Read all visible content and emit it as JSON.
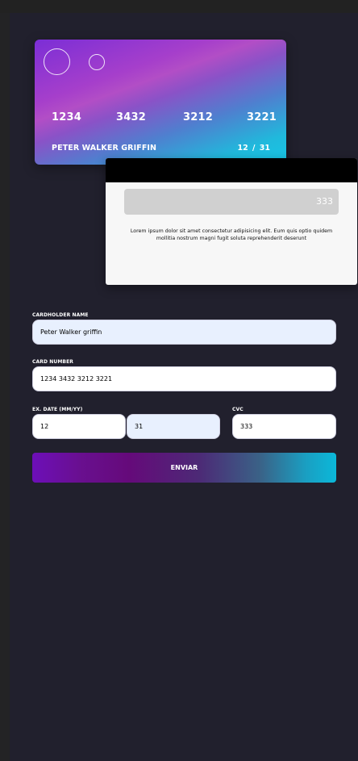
{
  "card_front": {
    "number_groups": [
      "1234",
      "3432",
      "3212",
      "3221"
    ],
    "holder_name": "PETER WALKER GRIFFIN",
    "expiry": "12 / 31"
  },
  "card_back": {
    "cvc": "333",
    "note": "Lorem ipsum dolor sit amet consectetur adipisicing elit. Eum quis optio quidem mollitia nostrum magni fugit soluta reprehenderit deserunt"
  },
  "form": {
    "cardholder_label": "CARDHOLDER NAME",
    "cardholder_value": "Peter Walker griffin",
    "card_number_label": "CARD NUMBER",
    "card_number_value": "1234 3432 3212 3221",
    "exp_label": "EX. DATE (MM/YY)",
    "exp_month_value": "12",
    "exp_year_value": "31",
    "cvc_label": "CVC",
    "cvc_value": "333",
    "submit_label": "ENVIAR"
  },
  "colors": {
    "background": "#21202d",
    "input_autofill": "#e8f0fe",
    "button_gradient_start": "#6d0fb8",
    "button_gradient_end": "#0bb8d9"
  }
}
